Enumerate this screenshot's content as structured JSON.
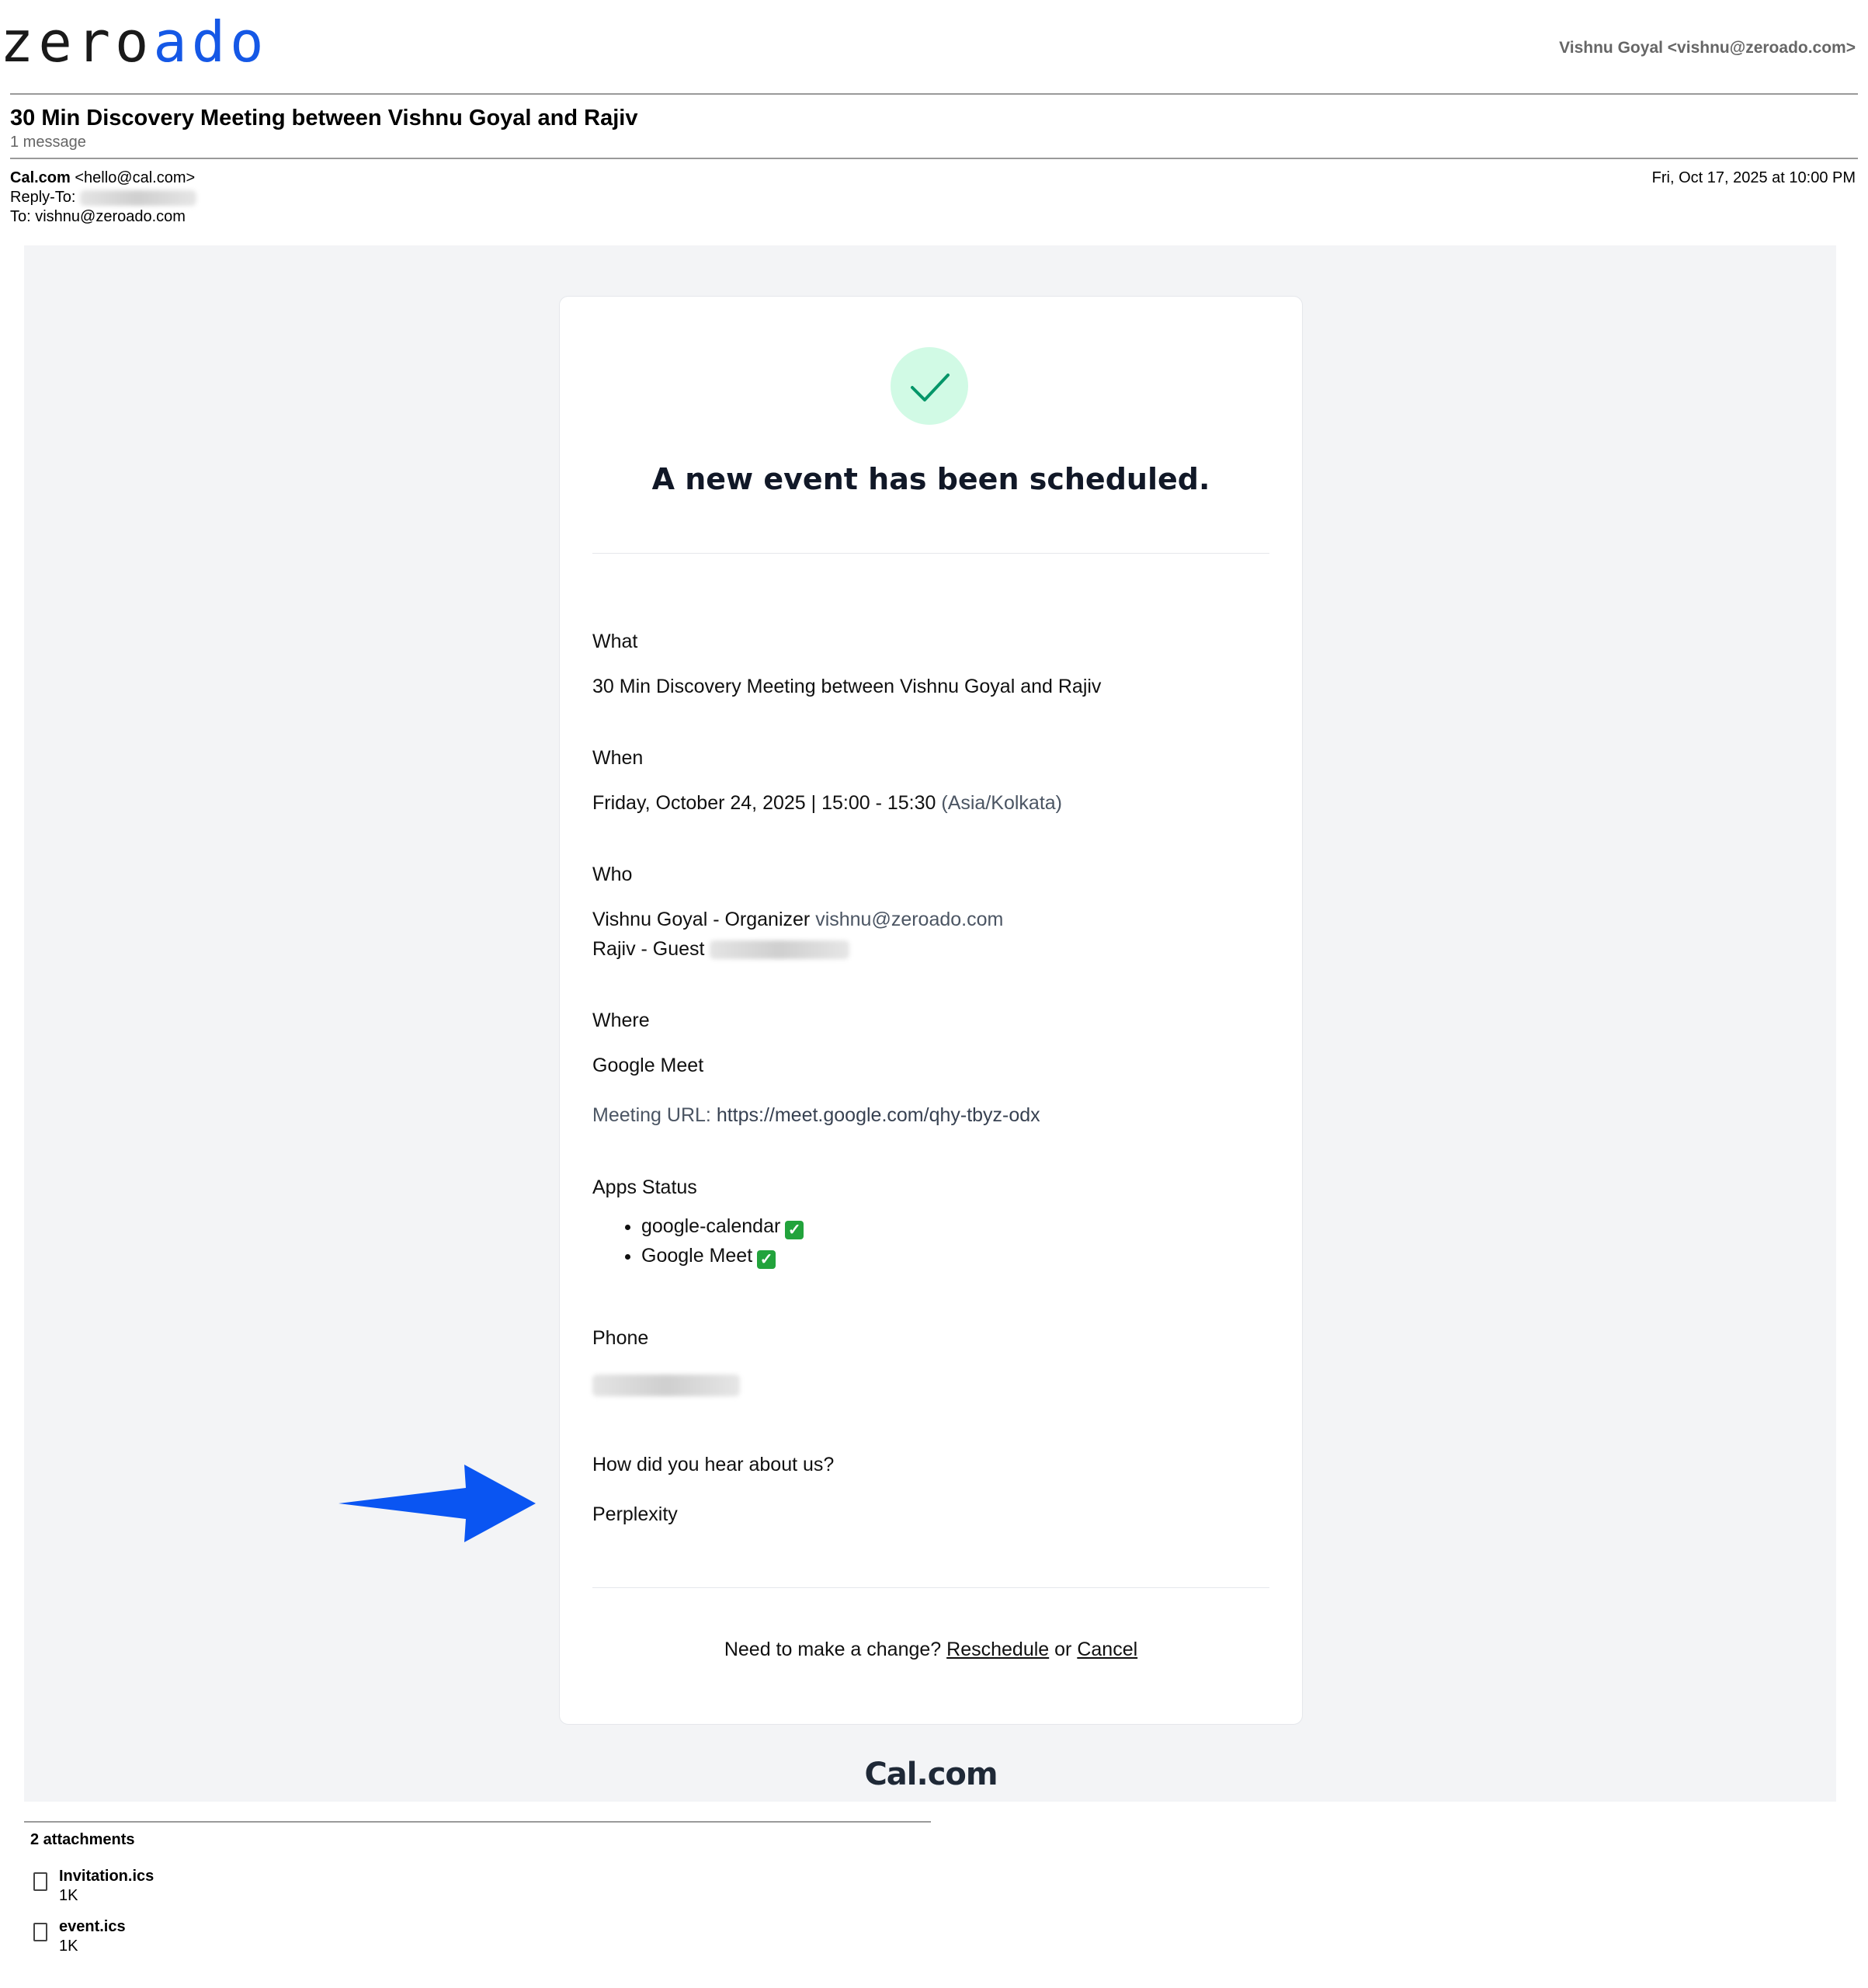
{
  "header": {
    "logo_part1": "zero",
    "logo_part2": "ado",
    "account": "Vishnu Goyal <vishnu@zeroado.com>"
  },
  "thread": {
    "subject": "30 Min Discovery Meeting between Vishnu Goyal and Rajiv",
    "message_count": "1 message"
  },
  "message": {
    "from_name": "Cal.com",
    "from_email": "<hello@cal.com>",
    "reply_to_label": "Reply-To:",
    "to": "To: vishnu@zeroado.com",
    "date": "Fri, Oct 17, 2025 at 10:00 PM"
  },
  "email": {
    "heading": "A new event has been scheduled.",
    "what_label": "What",
    "what_value": "30 Min Discovery Meeting between Vishnu Goyal and Rajiv",
    "when_label": "When",
    "when_value": "Friday, October 24, 2025 | 15:00 - 15:30",
    "when_tz": "(Asia/Kolkata)",
    "who_label": "Who",
    "organizer": "Vishnu Goyal - Organizer",
    "organizer_email": "vishnu@zeroado.com",
    "guest": "Rajiv - Guest",
    "where_label": "Where",
    "where_value": "Google Meet",
    "meeting_url_label": "Meeting URL:",
    "meeting_url": "https://meet.google.com/qhy-tbyz-odx",
    "apps_label": "Apps Status",
    "apps": [
      {
        "name": "google-calendar"
      },
      {
        "name": "Google Meet"
      }
    ],
    "phone_label": "Phone",
    "hear_label": "How did you hear about us?",
    "hear_value": "Perplexity",
    "change_text": "Need to make a change?",
    "reschedule": "Reschedule",
    "or_text": "or",
    "cancel": "Cancel",
    "brand": "Cal.com"
  },
  "attachments": {
    "title": "2 attachments",
    "files": [
      {
        "name": "Invitation.ics",
        "size": "1K"
      },
      {
        "name": "event.ics",
        "size": "1K"
      }
    ]
  },
  "colors": {
    "logo_blue": "#1558e6",
    "arrow_blue": "#0a55f2",
    "check_green": "#22a33c",
    "success_bg": "#d1fae5",
    "canvas_bg": "#f3f4f6"
  },
  "icons": [
    "check-icon",
    "arrow-right-icon",
    "checkbox-checked-icon",
    "file-icon"
  ]
}
